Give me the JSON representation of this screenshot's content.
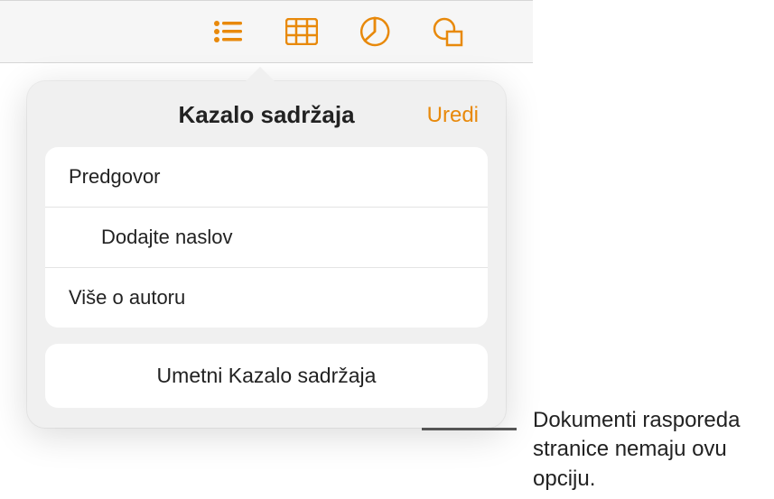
{
  "toolbar": {
    "icons": [
      "list-icon",
      "table-icon",
      "chart-icon",
      "shape-icon"
    ]
  },
  "popover": {
    "title": "Kazalo sadržaja",
    "edit_label": "Uredi",
    "toc_items": [
      {
        "label": "Predgovor",
        "indent": false
      },
      {
        "label": "Dodajte naslov",
        "indent": true
      },
      {
        "label": "Više o autoru",
        "indent": false
      }
    ],
    "insert_button": "Umetni Kazalo sadržaja"
  },
  "callout": {
    "text": "Dokumenti rasporeda stranice nemaju ovu opciju."
  },
  "colors": {
    "accent": "#e8890b"
  }
}
